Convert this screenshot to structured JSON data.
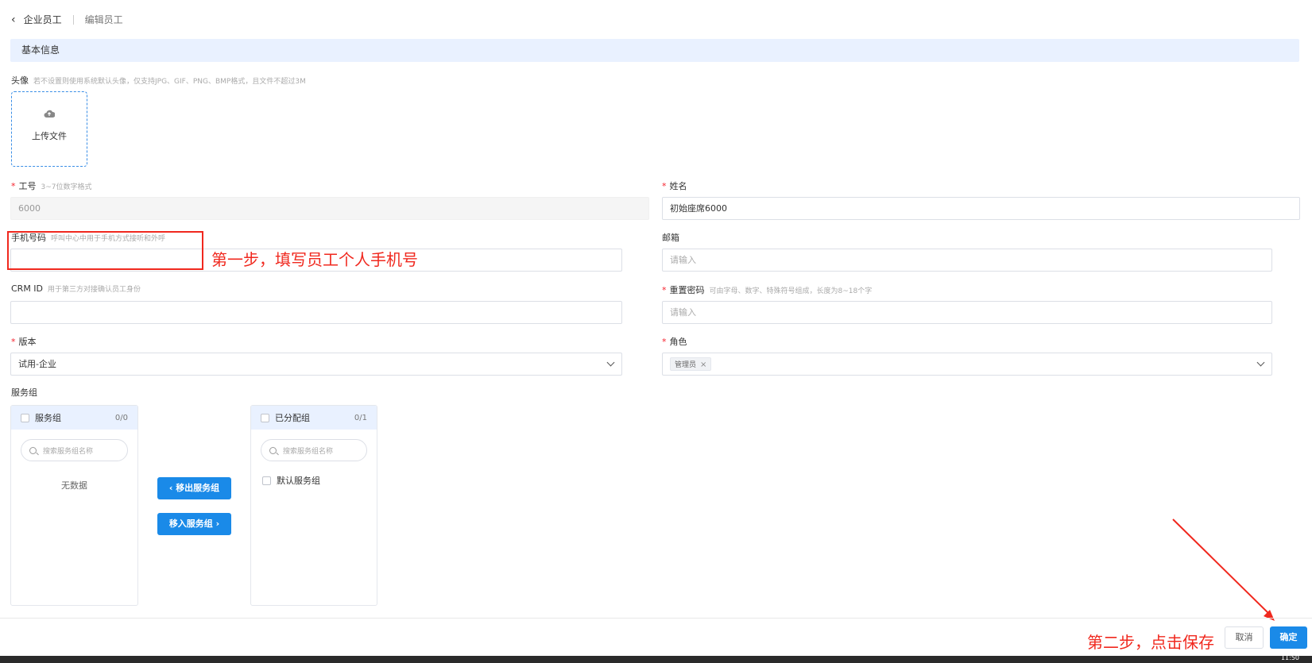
{
  "breadcrumb": {
    "parent": "企业员工",
    "current": "编辑员工"
  },
  "section": {
    "title": "基本信息"
  },
  "avatar": {
    "label": "头像",
    "hint": "若不设置则使用系统默认头像，仅支持JPG、GIF、PNG、BMP格式，且文件不超过3M",
    "upload_label": "上传文件",
    "icon": "cloud-upload-icon"
  },
  "fields": {
    "employee_id": {
      "label": "工号",
      "hint": "3~7位数字格式",
      "value": "6000",
      "required": true
    },
    "name": {
      "label": "姓名",
      "value": "初始座席6000",
      "required": true
    },
    "phone": {
      "label": "手机号码",
      "hint": "呼叫中心中用于手机方式接听和外呼",
      "value": ""
    },
    "email": {
      "label": "邮箱",
      "placeholder": "请输入"
    },
    "crm_id": {
      "label": "CRM ID",
      "hint": "用于第三方对接确认员工身份",
      "value": ""
    },
    "password": {
      "label": "重置密码",
      "hint": "可由字母、数字、特殊符号组成，长度为8~18个字",
      "placeholder": "请输入",
      "required": true
    },
    "version": {
      "label": "版本",
      "value": "试用-企业",
      "required": true
    },
    "role": {
      "label": "角色",
      "tags": [
        "管理员"
      ],
      "required": true
    }
  },
  "service_group": {
    "label": "服务组",
    "left_panel": {
      "title": "服务组",
      "count": "0/0",
      "search_placeholder": "搜索服务组名称",
      "empty_text": "无数据"
    },
    "right_panel": {
      "title": "已分配组",
      "count": "0/1",
      "search_placeholder": "搜索服务组名称",
      "items": [
        "默认服务组"
      ]
    },
    "move_out_label": "移出服务组",
    "move_in_label": "移入服务组"
  },
  "annotations": {
    "step1": "第一步，填写员工个人手机号",
    "step2": "第二步，点击保存"
  },
  "footer": {
    "cancel_label": "取消",
    "confirm_label": "确定"
  },
  "taskbar": {
    "clock": "11:50"
  },
  "colors": {
    "primary": "#1a8ae8",
    "annotation": "#f0281e",
    "section_bg": "#e9f1ff"
  }
}
